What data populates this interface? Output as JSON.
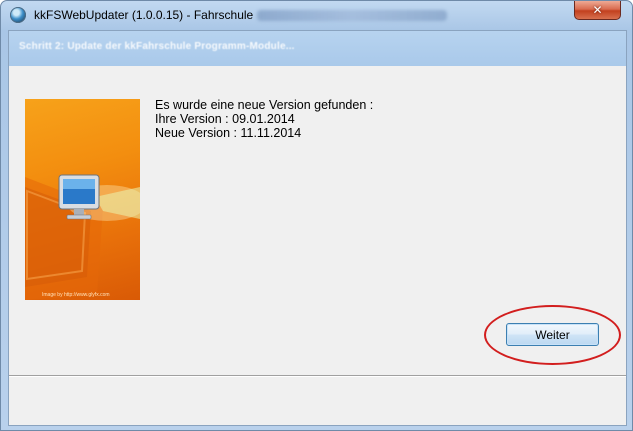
{
  "window": {
    "title": "kkFSWebUpdater (1.0.0.15)  -  Fahrschule",
    "close_glyph": "✕"
  },
  "header": {
    "step_text": "Schritt 2:  Update der kkFahrschule Programm-Module..."
  },
  "image": {
    "credit": "Image by http://www.glyfx.com"
  },
  "info": {
    "line1": "Es wurde eine neue Version gefunden :",
    "line2": "Ihre Version : 09.01.2014",
    "line3": "Neue Version : 11.11.2014"
  },
  "buttons": {
    "next_label": "Weiter"
  },
  "annotation": {
    "color": "#d21e1e"
  }
}
